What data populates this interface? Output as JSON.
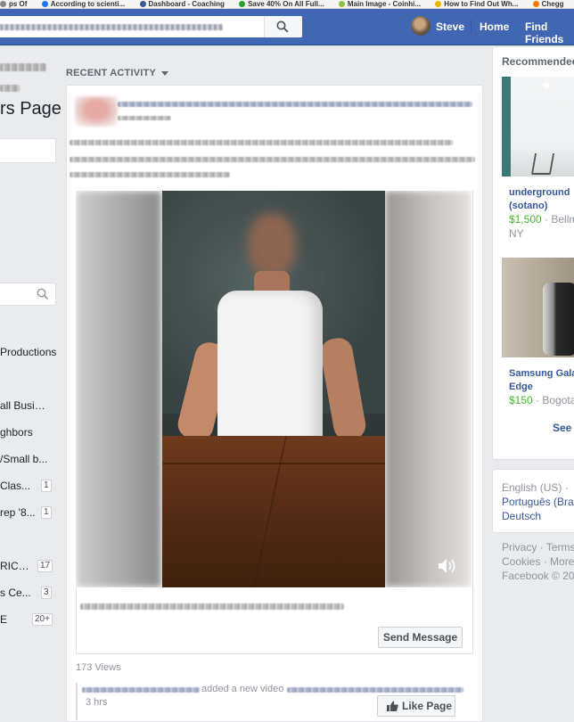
{
  "bookmarks": [
    "ps Of",
    "According to scienti...",
    "Dashboard - Coaching",
    "Save 40% On All Full...",
    "Main Image - Coinhi...",
    "How to Find Out Wh...",
    "Chegg"
  ],
  "topbar": {
    "user_name": "Steve",
    "home_label": "Home",
    "find_friends_label": "Find Friends"
  },
  "left": {
    "page_name": "rs Page",
    "items": [
      {
        "label": "Productions",
        "badge": ""
      },
      {
        "label": "all Business",
        "badge": ""
      },
      {
        "label": "ghbors",
        "badge": ""
      },
      {
        "label": "/Small b...",
        "badge": ""
      },
      {
        "label": "Clas...",
        "badge": "1"
      },
      {
        "label": "rep '8...",
        "badge": "1"
      },
      {
        "label": "RICH...",
        "badge": "17"
      },
      {
        "label": "s Ce...",
        "badge": "3"
      },
      {
        "label": "E",
        "badge": "20+"
      }
    ]
  },
  "center": {
    "recent_activity_label": "RECENT ACTIVITY",
    "send_message_label": "Send Message",
    "views_label": "173 Views",
    "added_video_text": "added a new video",
    "time_label": "3 hrs",
    "like_page_label": "Like Page"
  },
  "right": {
    "recommended_title": "Recommended",
    "items": [
      {
        "title_line1": "underground",
        "title_line2": "(sotano)",
        "price": "$1,500",
        "location": "Bellm",
        "location2": "NY"
      },
      {
        "title_line1": "Samsung Gala",
        "title_line2": "Edge",
        "price": "$150",
        "location": "Bogota",
        "location2": ""
      }
    ],
    "see_more_label": "See",
    "languages": {
      "current": "English (US)",
      "other1": "Português (Bra",
      "other2": "Deutsch"
    },
    "footer": {
      "line1": "Privacy · Terms",
      "line2": "Cookies · More",
      "line3": "Facebook © 20"
    }
  },
  "colors": {
    "facebook_blue": "#4267b2",
    "link_blue": "#365899",
    "price_green": "#42b72a"
  }
}
